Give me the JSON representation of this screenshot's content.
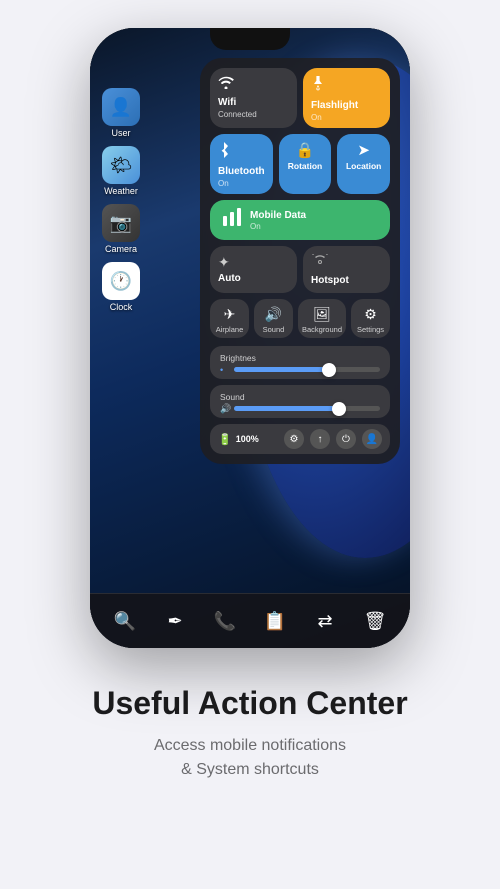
{
  "phone": {
    "screen": {
      "sidebar": {
        "apps": [
          {
            "id": "user",
            "label": "User",
            "emoji": "👤",
            "colorClass": "app-icon-user"
          },
          {
            "id": "weather",
            "label": "Weather",
            "emoji": "🌤",
            "colorClass": "app-icon-weather"
          },
          {
            "id": "camera",
            "label": "Camera",
            "emoji": "📷",
            "colorClass": "app-icon-camera"
          },
          {
            "id": "clock",
            "label": "Clock",
            "emoji": "🕐",
            "colorClass": "app-icon-clock"
          }
        ]
      },
      "controlCenter": {
        "wifi": {
          "label": "Wifi",
          "status": "Connected"
        },
        "flashlight": {
          "label": "Flashlight",
          "status": "On"
        },
        "bluetooth": {
          "label": "Bluetooth",
          "status": "On"
        },
        "rotation": {
          "label": "Rotation"
        },
        "location": {
          "label": "Location"
        },
        "mobileData": {
          "label": "Mobile Data",
          "status": "On"
        },
        "auto": {
          "label": "Auto"
        },
        "hotspot": {
          "label": "Hotspot"
        },
        "bottomButtons": [
          {
            "id": "airplane",
            "label": "Airplane"
          },
          {
            "id": "sound",
            "label": "Sound"
          },
          {
            "id": "background",
            "label": "Background"
          },
          {
            "id": "settings",
            "label": "Settings"
          }
        ],
        "sliders": {
          "brightness": {
            "label": "Brightnes",
            "value": 65
          },
          "sound": {
            "label": "Sound",
            "value": 72
          }
        },
        "statusBar": {
          "batteryPercent": "100%",
          "batteryIcon": "🔋"
        }
      }
    },
    "dock": {
      "icons": [
        "🔍",
        "✏",
        "📞",
        "📋",
        "🔄",
        "🗑"
      ]
    }
  },
  "textSection": {
    "title": "Useful Action Center",
    "subtitle": "Access mobile notifications\n& System shortcuts"
  }
}
